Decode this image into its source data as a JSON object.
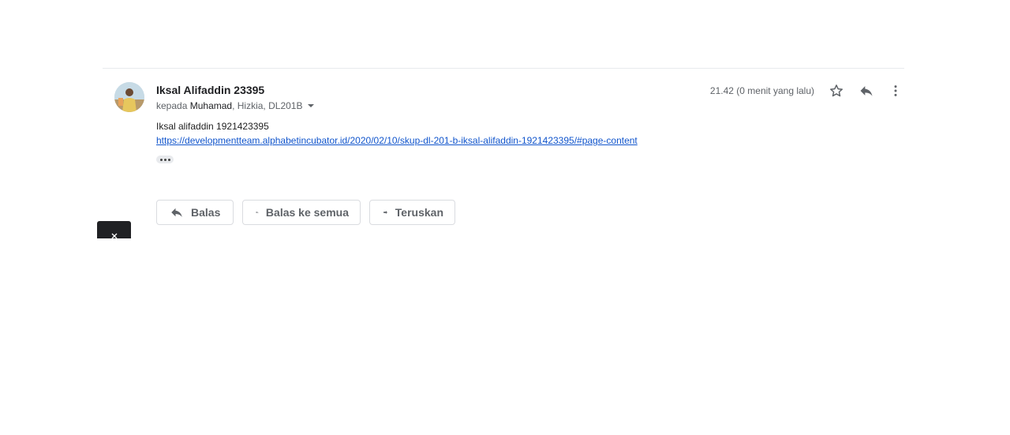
{
  "message": {
    "sender_name": "Iksal Alifaddin 23395",
    "recipients": {
      "prefix": "kepada",
      "primary": "Muhamad",
      "others": ", Hizkia, DL201B"
    },
    "timestamp": "21.42 (0 menit yang lalu)",
    "body_line1": "Iksal alifaddin 1921423395",
    "body_link": "https://developmentteam.alphabetincubator.id/2020/02/10/skup-dl-201-b-iksal-alifaddin-1921423395/#page-content"
  },
  "actions": {
    "reply_label": "Balas",
    "reply_all_label": "Balas ke semua",
    "forward_label": "Teruskan"
  },
  "icons": {
    "star": "star-icon",
    "reply": "reply-icon",
    "more": "more-vert-icon",
    "reply_all": "reply-all-icon",
    "forward": "forward-icon",
    "close": "close-icon"
  },
  "colors": {
    "link": "#1155cc",
    "muted": "#5f6368",
    "dark_tab": "#202124"
  }
}
